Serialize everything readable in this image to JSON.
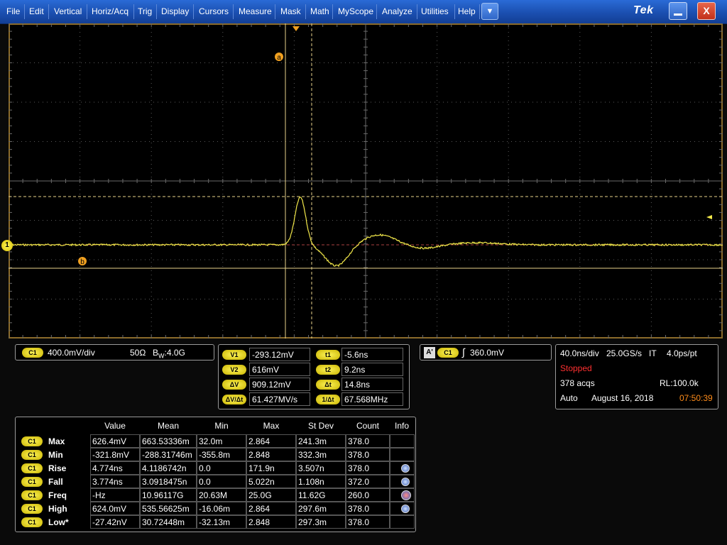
{
  "menu": {
    "items": [
      "File",
      "Edit",
      "Vertical",
      "Horiz/Acq",
      "Trig",
      "Display",
      "Cursors",
      "Measure",
      "Mask",
      "Math",
      "MyScope",
      "Analyze",
      "Utilities",
      "Help"
    ],
    "dropdown_glyph": "▼",
    "brand": "Tek",
    "close_glyph": "X"
  },
  "display": {
    "channel_marker": "1",
    "cursor_a_label": "a",
    "cursor_b_label": "b",
    "trace_color": "#f2e84a",
    "cursor_color": "#e8d28a",
    "grid_color": "#5a5a5a"
  },
  "channel_panel": {
    "badge": "C1",
    "scale": "400.0mV/div",
    "impedance": "50Ω",
    "bandwidth_prefix": "B",
    "bandwidth_sub": "W",
    "bandwidth_value": ":4.0G"
  },
  "cursor_readout": {
    "rows": [
      {
        "tag": "V1",
        "value": "-293.12mV",
        "tag2": "t1",
        "value2": "-5.6ns"
      },
      {
        "tag": "V2",
        "value": "616mV",
        "tag2": "t2",
        "value2": "9.2ns"
      },
      {
        "tag": "ΔV",
        "value": "909.12mV",
        "tag2": "Δt",
        "value2": "14.8ns"
      },
      {
        "tag": "ΔV/Δt",
        "value": "61.427MV/s",
        "tag2": "1/Δt",
        "value2": "67.568MHz"
      }
    ]
  },
  "trigger_panel": {
    "mode_badge": "A'",
    "source_badge": "C1",
    "slope_glyph": "∫",
    "level": "360.0mV"
  },
  "acquisition_panel": {
    "horizontal": "40.0ns/div",
    "sample_rate": "25.0GS/s",
    "mode": "IT",
    "resolution": "4.0ps/pt",
    "state": "Stopped",
    "acqs": "378 acqs",
    "record_length": "RL:100.0k",
    "trigger_mode": "Auto",
    "date": "August 16, 2018",
    "time": "07:50:39"
  },
  "measurements": {
    "headers": [
      "Value",
      "Mean",
      "Min",
      "Max",
      "St Dev",
      "Count",
      "Info"
    ],
    "rows": [
      {
        "source": "C1",
        "name": "Max",
        "value": "626.4mV",
        "mean": "663.53336m",
        "min": "32.0m",
        "max": "2.864",
        "stdev": "241.3m",
        "count": "378.0",
        "info": ""
      },
      {
        "source": "C1",
        "name": "Min",
        "value": "-321.8mV",
        "mean": "-288.31746m",
        "min": "-355.8m",
        "max": "2.848",
        "stdev": "332.3m",
        "count": "378.0",
        "info": ""
      },
      {
        "source": "C1",
        "name": "Rise",
        "value": "4.774ns",
        "mean": "4.1186742n",
        "min": "0.0",
        "max": "171.9n",
        "stdev": "3.507n",
        "count": "378.0",
        "info": "info-icon"
      },
      {
        "source": "C1",
        "name": "Fall",
        "value": "3.774ns",
        "mean": "3.0918475n",
        "min": "0.0",
        "max": "5.022n",
        "stdev": "1.108n",
        "count": "372.0",
        "info": "info-icon"
      },
      {
        "source": "C1",
        "name": "Freq",
        "value": "-Hz",
        "mean": "10.96117G",
        "min": "20.63M",
        "max": "25.0G",
        "stdev": "11.62G",
        "count": "260.0",
        "info": "warning-info-icon"
      },
      {
        "source": "C1",
        "name": "High",
        "value": "624.0mV",
        "mean": "535.56625m",
        "min": "-16.06m",
        "max": "2.864",
        "stdev": "297.6m",
        "count": "378.0",
        "info": "info-icon"
      },
      {
        "source": "C1",
        "name": "Low*",
        "value": "-27.42nV",
        "mean": "30.72448m",
        "min": "-32.13m",
        "max": "2.848",
        "stdev": "297.3m",
        "count": "378.0",
        "info": ""
      }
    ]
  }
}
